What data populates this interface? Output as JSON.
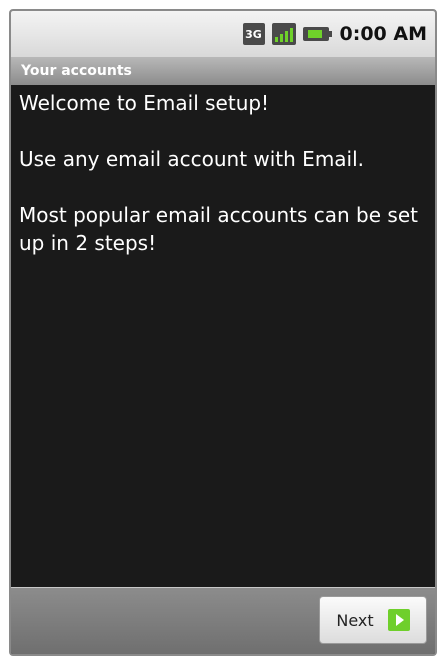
{
  "status_bar": {
    "network_badge": "3G",
    "time": "0:00 AM",
    "icons": [
      "network-3g-icon",
      "signal-icon",
      "battery-icon"
    ]
  },
  "header": {
    "title": "Your accounts"
  },
  "main": {
    "paragraphs": [
      "Welcome to Email setup!",
      "Use any email account with Email.",
      "Most popular email accounts can be set up in 2 steps!"
    ]
  },
  "footer": {
    "next_label": "Next"
  },
  "colors": {
    "accent_green": "#6fcf2b",
    "background": "#1a1a1a"
  }
}
